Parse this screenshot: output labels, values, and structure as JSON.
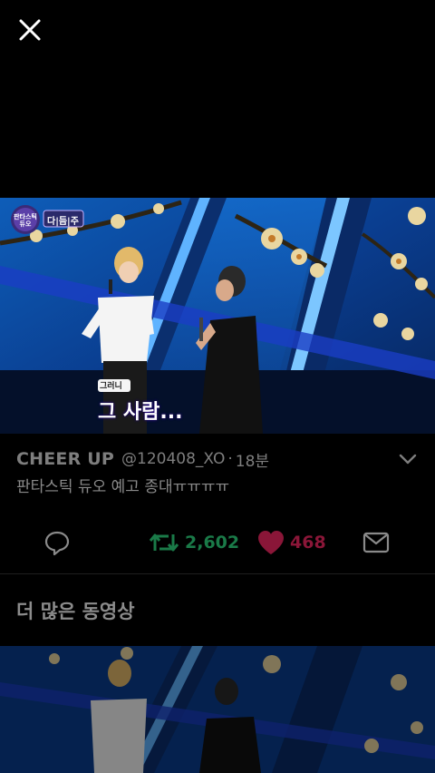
{
  "video": {
    "logo_text": "판타스틱 듀오",
    "tag_text": "다|듬|주",
    "subtitle_small": "그러니",
    "subtitle_main": "그 사람..."
  },
  "tweet": {
    "display_name": "CHEER UP",
    "handle": "@120408_XO",
    "separator": "·",
    "time": "18분",
    "text": "판타스틱 듀오 예고 종대ㅠㅠㅠㅠ",
    "retweet_count": "2,602",
    "like_count": "468"
  },
  "section": {
    "more_videos_title": "더 많은 동영상"
  },
  "colors": {
    "background": "#000000",
    "retweet": "#1a7a48",
    "like": "#8a1638",
    "muted": "#7e7e7e"
  },
  "icons": {
    "close": "close-icon",
    "chevron": "chevron-down-icon",
    "reply": "reply-icon",
    "retweet": "retweet-icon",
    "like": "heart-icon",
    "mail": "mail-icon"
  }
}
